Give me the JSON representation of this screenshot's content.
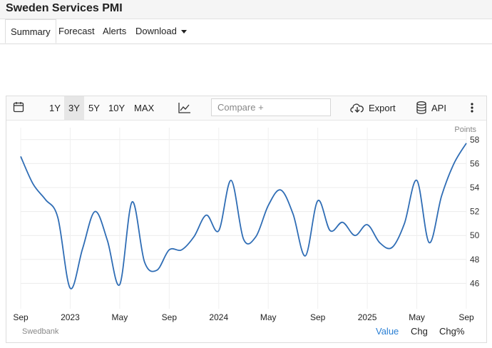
{
  "page_title": "Sweden Services PMI",
  "tabs": [
    {
      "label": "Summary"
    },
    {
      "label": "Forecast"
    },
    {
      "label": "Alerts"
    },
    {
      "label": "Download"
    }
  ],
  "toolbar": {
    "ranges": [
      "1Y",
      "3Y",
      "5Y",
      "10Y",
      "MAX"
    ],
    "selected_range": "3Y",
    "compare_placeholder": "Compare +",
    "export_label": "Export",
    "api_label": "API",
    "icons": [
      "calendar-icon",
      "line-chart-icon",
      "cloud-download-icon",
      "database-icon",
      "more-vertical-icon"
    ]
  },
  "footer": {
    "source": "Swedbank",
    "value_label": "Value",
    "chg_label": "Chg",
    "chgpct_label": "Chg%"
  },
  "colors": {
    "line": "#2f6db5",
    "active_link": "#2a7fd4"
  },
  "chart_data": {
    "type": "line",
    "unit_label": "Points",
    "x": [
      "2022-09",
      "2022-10",
      "2022-11",
      "2022-12",
      "2023-01",
      "2023-02",
      "2023-03",
      "2023-04",
      "2023-05",
      "2023-06",
      "2023-07",
      "2023-08",
      "2023-09",
      "2023-10",
      "2023-11",
      "2023-12",
      "2024-01",
      "2024-02",
      "2024-03",
      "2024-04",
      "2024-05",
      "2024-06",
      "2024-07",
      "2024-08",
      "2024-09",
      "2024-10",
      "2024-11",
      "2024-12",
      "2025-01",
      "2025-02",
      "2025-03",
      "2025-04",
      "2025-05",
      "2025-06",
      "2025-07",
      "2025-08",
      "2025-09"
    ],
    "series": [
      {
        "values": [
          56.6,
          54.3,
          53.0,
          51.5,
          45.6,
          48.9,
          52.0,
          49.6,
          45.9,
          52.8,
          47.8,
          47.1,
          48.8,
          48.8,
          49.9,
          51.7,
          50.4,
          54.6,
          49.7,
          49.9,
          52.5,
          53.8,
          51.8,
          48.3,
          52.9,
          50.4,
          51.1,
          50.0,
          50.9,
          49.4,
          49.0,
          51.0,
          54.6,
          49.4,
          53.3,
          56.0,
          57.7
        ]
      }
    ],
    "x_tick_labels": [
      "Sep",
      "2023",
      "May",
      "Sep",
      "2024",
      "May",
      "Sep",
      "2025",
      "May",
      "Sep"
    ],
    "y_ticks": [
      46,
      48,
      50,
      52,
      54,
      56,
      58
    ],
    "ylim": [
      44,
      59
    ],
    "grid": true,
    "y_axis_side": "right"
  }
}
